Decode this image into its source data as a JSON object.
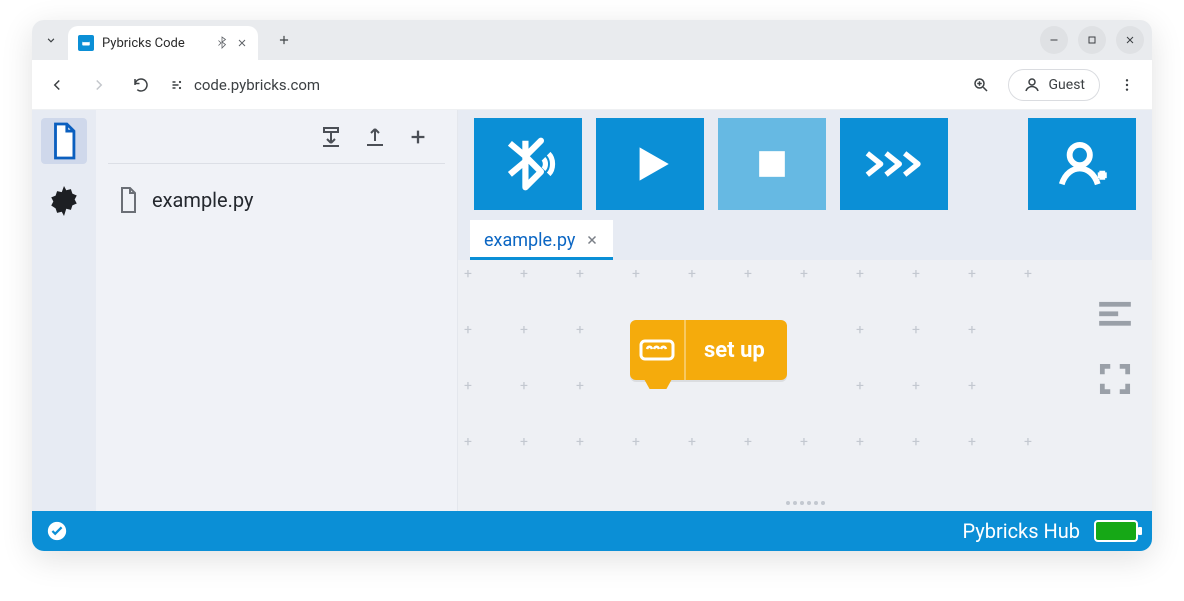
{
  "browser": {
    "tab_title": "Pybricks Code",
    "url": "code.pybricks.com",
    "guest_label": "Guest"
  },
  "files": {
    "items": [
      {
        "name": "example.py"
      }
    ]
  },
  "editor": {
    "tabs": [
      {
        "label": "example.py"
      }
    ],
    "block_label": "set up"
  },
  "status": {
    "hub_label": "Pybricks Hub"
  }
}
